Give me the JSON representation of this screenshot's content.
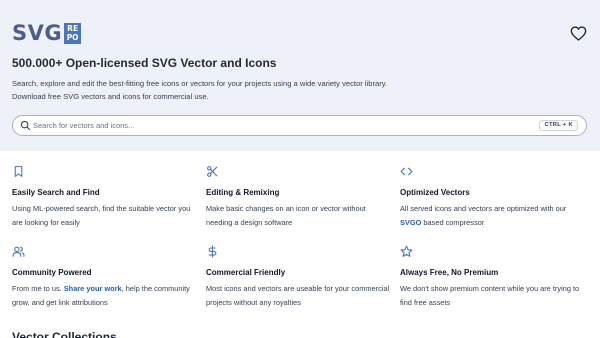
{
  "logo": {
    "text": "SVG",
    "badge_top": "RE",
    "badge_bottom": "PO"
  },
  "hero": {
    "title": "500.000+ Open-licensed SVG Vector and Icons",
    "desc_line1": "Search, explore and edit the best-fitting free icons or vectors for your projects using a wide variety vector library.",
    "desc_line2": "Download free SVG vectors and icons for commercial use."
  },
  "search": {
    "placeholder": "Search for vectors and icons...",
    "shortcut": "CTRL + K"
  },
  "features": [
    {
      "icon": "bookmark-icon",
      "title": "Easily Search and Find",
      "desc": "Using ML-powered search, find the suitable vector you are looking for easily"
    },
    {
      "icon": "scissors-icon",
      "title": "Editing & Remixing",
      "desc": "Make basic changes on an icon or vector without needing a design software"
    },
    {
      "icon": "code-icon",
      "title": "Optimized Vectors",
      "desc_before": "All served icons and vectors are optimized with our ",
      "desc_link": "SVGO",
      "desc_after": " based compressor"
    },
    {
      "icon": "users-icon",
      "title": "Community Powered",
      "desc_before": "From me to us. ",
      "desc_link": "Share your work",
      "desc_after": ", help the community grow, and get link attributions"
    },
    {
      "icon": "dollar-icon",
      "title": "Commercial Friendly",
      "desc": "Most icons and vectors are useable for your commercial projects without any royalties"
    },
    {
      "icon": "star-icon",
      "title": "Always Free, No Premium",
      "desc": "We don't show premium content while you are trying to find free assets"
    }
  ],
  "sections": {
    "collections_title": "Vector Collections"
  },
  "colors": {
    "accent": "#4a76b8",
    "hero_bg": "#eef2f8",
    "link": "#2563b0",
    "logo_text": "#4c5e8a"
  }
}
